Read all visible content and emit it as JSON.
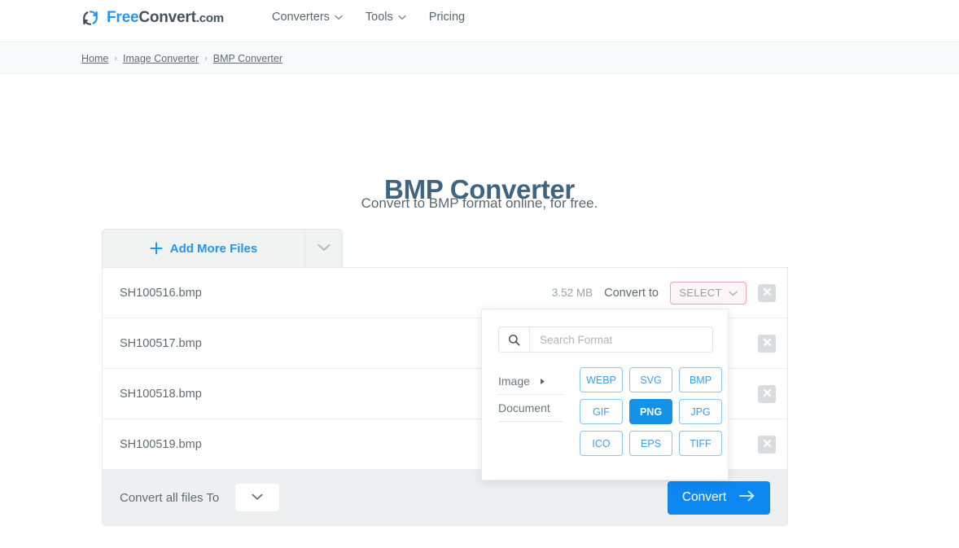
{
  "header": {
    "brand": {
      "free": "Free",
      "convert": "Convert",
      "com": ".com",
      "icon": "refresh-circle-icon"
    },
    "nav": [
      {
        "label": "Converters",
        "has_caret": true
      },
      {
        "label": "Tools",
        "has_caret": true
      },
      {
        "label": "Pricing",
        "has_caret": false
      }
    ]
  },
  "breadcrumb": {
    "items": [
      "Home",
      "Image Converter",
      "BMP Converter"
    ],
    "separator": "›"
  },
  "hero": {
    "title": "BMP Converter",
    "subtitle": "Convert to BMP format online, for free."
  },
  "tabs": {
    "add_more_files": "Add More Files",
    "caret_icon": "chevron-down-icon"
  },
  "files": {
    "rows": [
      {
        "name": "SH100516.bmp",
        "size": "3.52 MB",
        "convert_to_label": "Convert to",
        "select_label": "SELECT"
      },
      {
        "name": "SH100517.bmp",
        "size": "",
        "convert_to_label": "",
        "select_label": ""
      },
      {
        "name": "SH100518.bmp",
        "size": "",
        "convert_to_label": "",
        "select_label": ""
      },
      {
        "name": "SH100519.bmp",
        "size": "",
        "convert_to_label": "",
        "select_label": ""
      }
    ]
  },
  "footer": {
    "convert_all_label": "Convert all files To",
    "convert_button": "Convert",
    "arrow_icon": "arrow-right-icon"
  },
  "format_dropdown": {
    "search_placeholder": "Search Format",
    "search_value": "",
    "categories": [
      {
        "label": "Image",
        "has_arrow": true
      },
      {
        "label": "Document",
        "has_arrow": false
      }
    ],
    "formats": [
      {
        "label": "WEBP",
        "selected": false
      },
      {
        "label": "SVG",
        "selected": false
      },
      {
        "label": "BMP",
        "selected": false
      },
      {
        "label": "GIF",
        "selected": false
      },
      {
        "label": "PNG",
        "selected": true
      },
      {
        "label": "JPG",
        "selected": false
      },
      {
        "label": "ICO",
        "selected": false
      },
      {
        "label": "EPS",
        "selected": false
      },
      {
        "label": "TIFF",
        "selected": false
      }
    ]
  },
  "colors": {
    "brand_blue": "#2196f3",
    "convert_blue": "#0d88f0",
    "selected_chip": "#1592e6",
    "title": "#3e6480",
    "select_border": "#e8a9ae"
  }
}
